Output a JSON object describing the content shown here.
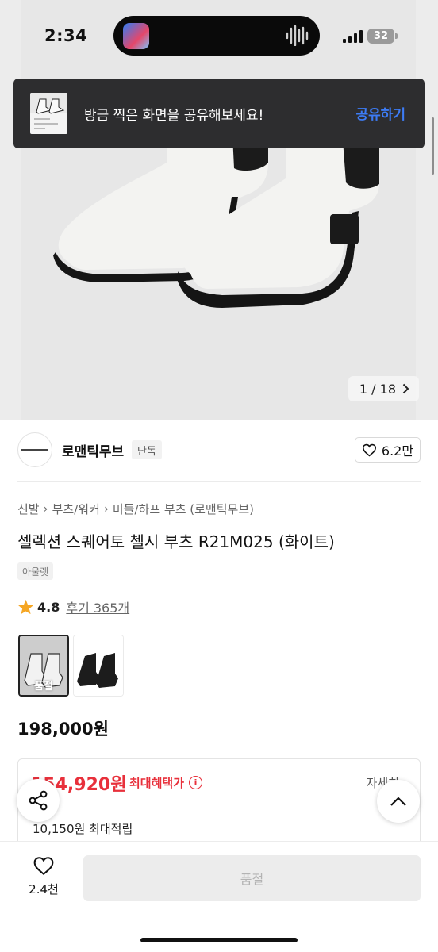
{
  "status_bar": {
    "time": "2:34",
    "battery": "32"
  },
  "hero": {
    "counter": "1 / 18"
  },
  "toast": {
    "message": "방금 찍은 화면을 공유해보세요!",
    "action": "공유하기"
  },
  "brand": {
    "name": "로맨틱무브",
    "badge": "단독",
    "likes": "6.2만"
  },
  "breadcrumb": [
    "신발",
    "부츠/워커",
    "미들/하프 부츠 (로맨틱무브)"
  ],
  "product": {
    "title": "셀렉션 스퀘어토 첼시 부츠 R21M025 (화이트)",
    "tag": "아울렛",
    "rating": "4.8",
    "reviews": "후기 365개",
    "option_soldout_label": "품절",
    "price": "198,000원"
  },
  "benefit": {
    "price": "154,920원",
    "label": "최대혜택가",
    "detail": "자세히",
    "points": "10,150원 최대적립"
  },
  "bottom_bar": {
    "wish_count": "2.4천",
    "buy_label": "품절"
  },
  "colors": {
    "accent_blue": "#3d7cf5",
    "sale_red": "#e8303b",
    "star": "#f5a623"
  }
}
